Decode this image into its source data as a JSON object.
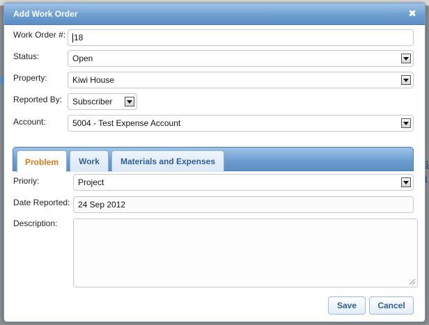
{
  "dialog": {
    "title": "Add Work Order",
    "close_icon": "close-icon"
  },
  "form": {
    "work_order_label": "Work Order #:",
    "work_order_value": "18",
    "status_label": "Status:",
    "status_value": "Open",
    "property_label": "Property:",
    "property_value": "Kiwi House",
    "reported_by_label": "Reported By:",
    "reported_by_value": "Subscriber",
    "account_label": "Account:",
    "account_value": "5004 - Test Expense Account"
  },
  "tabs": [
    {
      "label": "Problem",
      "active": true
    },
    {
      "label": "Work",
      "active": false
    },
    {
      "label": "Materials and Expenses",
      "active": false
    }
  ],
  "problem": {
    "priority_label": "Prioriy:",
    "priority_value": "Project",
    "date_label": "Date Reported:",
    "date_value": "24 Sep 2012",
    "description_label": "Description:",
    "description_value": ""
  },
  "buttons": {
    "save": "Save",
    "cancel": "Cancel"
  },
  "background": {
    "edge_text_1": "S",
    "edge_text_2": "1"
  },
  "colors": {
    "accent": "#5b8dc4",
    "active_tab_text": "#e07b10",
    "tab_text": "#2e5f98"
  }
}
